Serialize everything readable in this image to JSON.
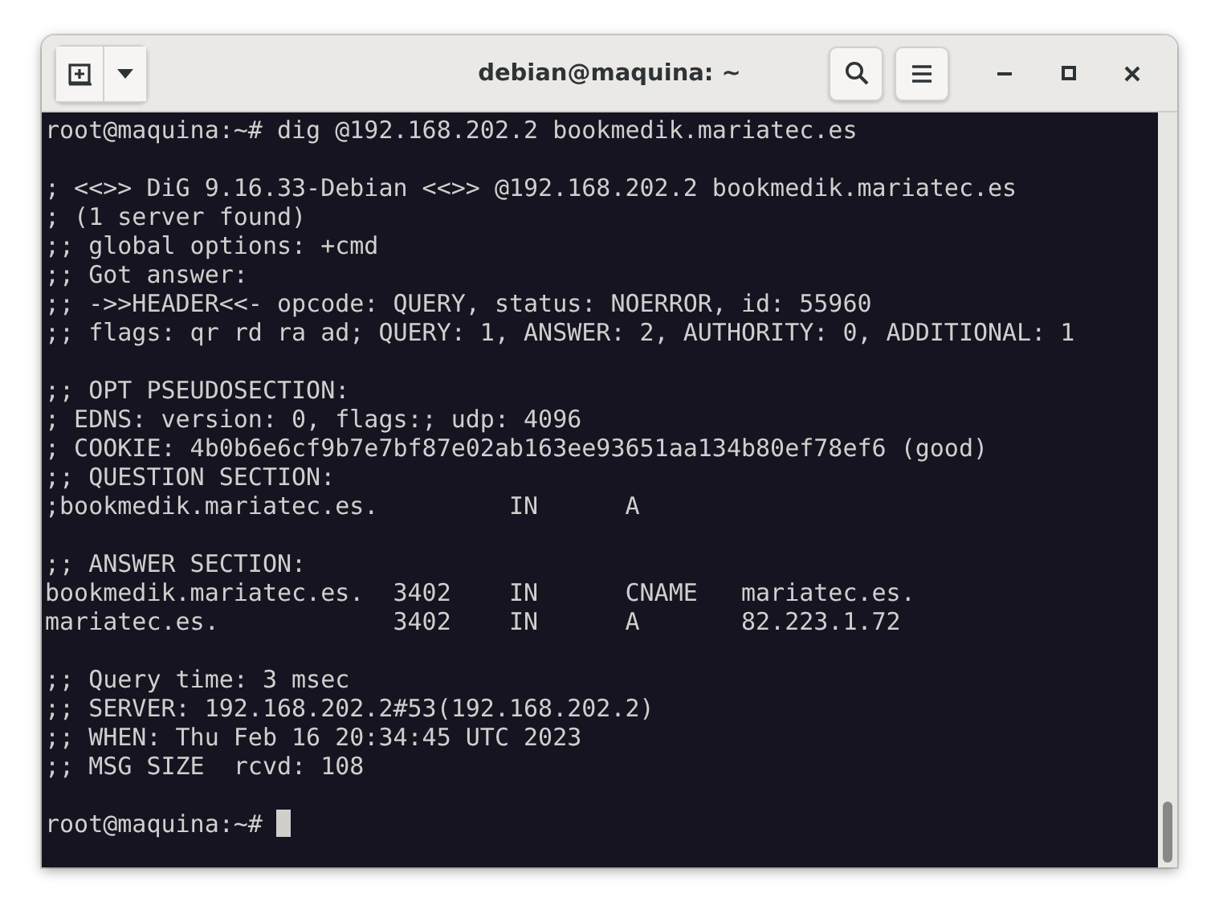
{
  "window": {
    "title": "debian@maquina: ~"
  },
  "terminal": {
    "blocks": [
      [
        "root@maquina:~# dig @192.168.202.2 bookmedik.mariatec.es"
      ],
      [
        "; <<>> DiG 9.16.33-Debian <<>> @192.168.202.2 bookmedik.mariatec.es",
        "; (1 server found)",
        ";; global options: +cmd",
        ";; Got answer:",
        ";; ->>HEADER<<- opcode: QUERY, status: NOERROR, id: 55960",
        ";; flags: qr rd ra ad; QUERY: 1, ANSWER: 2, AUTHORITY: 0, ADDITIONAL: 1"
      ],
      [
        ";; OPT PSEUDOSECTION:",
        "; EDNS: version: 0, flags:; udp: 4096",
        "; COOKIE: 4b0b6e6cf9b7e7bf87e02ab163ee93651aa134b80ef78ef6 (good)",
        ";; QUESTION SECTION:",
        ";bookmedik.mariatec.es.         IN      A"
      ],
      [
        ";; ANSWER SECTION:",
        "bookmedik.mariatec.es.  3402    IN      CNAME   mariatec.es.",
        "mariatec.es.            3402    IN      A       82.223.1.72"
      ],
      [
        ";; Query time: 3 msec",
        ";; SERVER: 192.168.202.2#53(192.168.202.2)",
        ";; WHEN: Thu Feb 16 20:34:45 UTC 2023",
        ";; MSG SIZE  rcvd: 108"
      ]
    ],
    "prompt": "root@maquina:~#",
    "cursor_visible": true
  }
}
